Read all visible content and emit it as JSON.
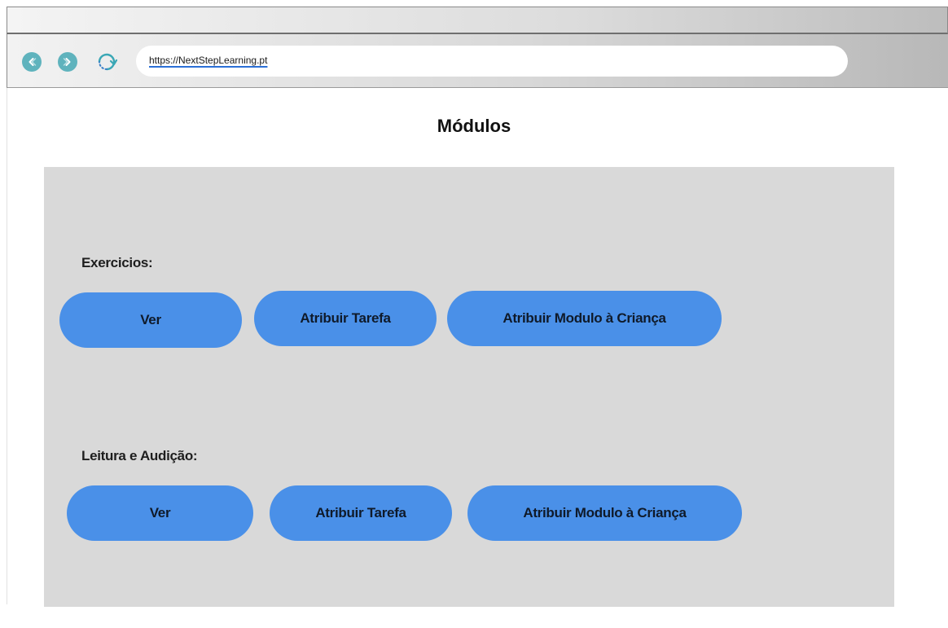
{
  "browser": {
    "back_icon": "chevron-left-icon",
    "forward_icon": "chevron-right-icon",
    "reload_icon": "reload-icon",
    "url": "https://NextStepLearning.pt",
    "nav_button_color": "#5fb3bd"
  },
  "page": {
    "title": "Módulos"
  },
  "sections": [
    {
      "label": "Exercicios:",
      "buttons": {
        "view": "Ver",
        "assign_task": "Atribuir Tarefa",
        "assign_module": "Atribuir Modulo à Criança"
      }
    },
    {
      "label": "Leitura e Audição:",
      "buttons": {
        "view": "Ver",
        "assign_task": "Atribuir Tarefa",
        "assign_module": "Atribuir Modulo à Criança"
      }
    }
  ],
  "colors": {
    "button": "#4a90e8",
    "panel": "#d9d9d9"
  }
}
